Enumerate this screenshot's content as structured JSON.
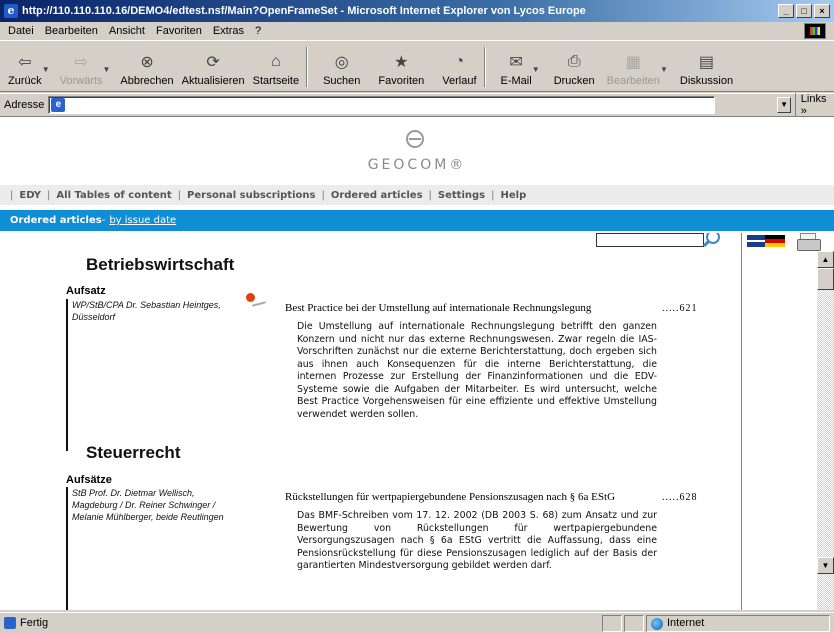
{
  "window": {
    "title": "http://110.110.110.16/DEMO4/edtest.nsf/Main?OpenFrameSet - Microsoft Internet Explorer von Lycos Europe",
    "icon": "ie-icon"
  },
  "menu": [
    "Datei",
    "Bearbeiten",
    "Ansicht",
    "Favoriten",
    "Extras",
    "?"
  ],
  "toolbar": {
    "back": "Zurück",
    "forward": "Vorwärts",
    "stop": "Abbrechen",
    "refresh": "Aktualisieren",
    "home": "Startseite",
    "search": "Suchen",
    "favorites": "Favoriten",
    "history": "Verlauf",
    "mail": "E-Mail",
    "print": "Drucken",
    "edit": "Bearbeiten",
    "discuss": "Diskussion"
  },
  "address": {
    "label": "Adresse",
    "value": "",
    "links": "Links »"
  },
  "site": {
    "brand": "GEOCOM®",
    "nav": [
      "EDY",
      "All Tables of content",
      "Personal subscriptions",
      "Ordered articles",
      "Settings",
      "Help"
    ],
    "subnav_title": "Ordered articles",
    "subnav_sep": " - ",
    "subnav_link": "by issue date"
  },
  "sections": [
    {
      "title": "Betriebswirtschaft",
      "category": "Aufsatz",
      "author": "WP/StB/CPA Dr. Sebastian Heintges, Düsseldorf",
      "article_title": "Best Practice bei der Umstellung auf internationale Rechnungslegung",
      "page": ".....621",
      "abstract": "Die Umstellung auf internationale Rechnungslegung betrifft den ganzen Konzern und nicht nur das externe Rechnungswesen. Zwar regeln die IAS-Vorschriften zunächst nur die externe Berichterstattung, doch ergeben sich aus ihnen auch Konsequenzen für die interne Berichterstattung, die internen Prozesse zur Erstellung der Finanzinformationen und die EDV-Systeme sowie die Aufgaben der Mitarbeiter. Es wird untersucht, welche Best Practice Vorgehensweisen für eine effiziente und effektive Umstellung verwendet werden sollen."
    },
    {
      "title": "Steuerrecht",
      "category": "Aufsätze",
      "author": "StB Prof. Dr. Dietmar Wellisch, Magdeburg / Dr. Reiner Schwinger / Melanie Mühlberger, beide Reutlingen",
      "article_title": "Rückstellungen für wertpapiergebundene Pensionszusagen nach § 6a EStG",
      "page": ".....628",
      "abstract": "Das BMF-Schreiben vom 17. 12. 2002 (DB 2003 S. 68) zum Ansatz und zur Bewertung von Rückstellungen für wertpapiergebundene Versorgungszusagen nach § 6a EStG vertritt die Auffassung, dass eine Pensionsrückstellung für diese Pensionszusagen lediglich auf der Basis der garantierten Mindestversorgung gebildet werden darf."
    }
  ],
  "status": {
    "text": "Fertig",
    "zone": "Internet"
  }
}
